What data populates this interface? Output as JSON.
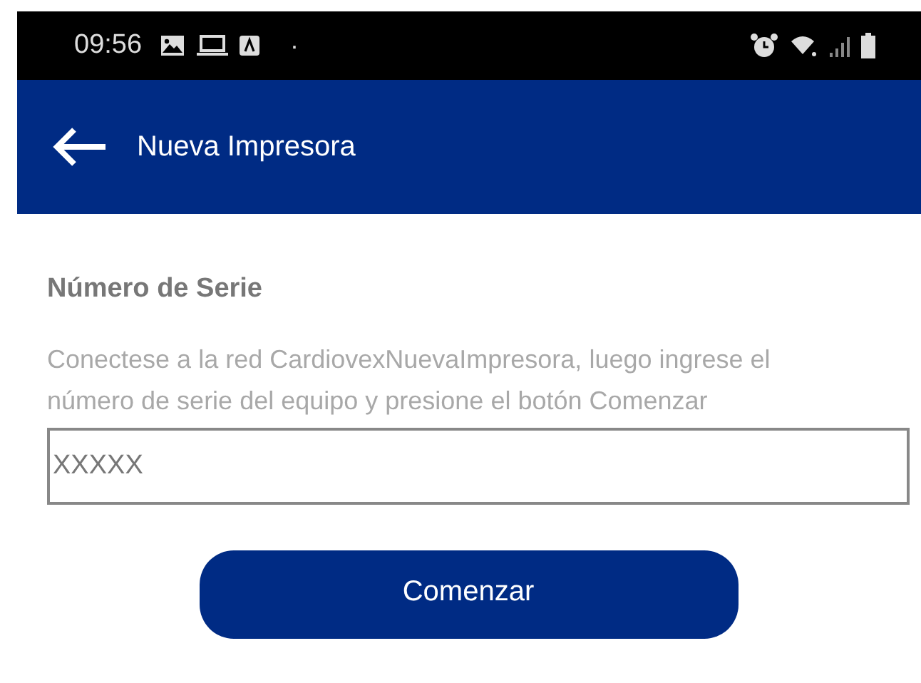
{
  "status_bar": {
    "time": "09:56",
    "dot": "·"
  },
  "app_bar": {
    "title": "Nueva Impresora"
  },
  "section": {
    "heading": "Número de Serie",
    "instructions": "Conectese a la red CardiovexNuevaImpresora, luego ingrese el número de serie del equipo y presione el botón Comenzar"
  },
  "serial_field": {
    "placeholder": "XXXXX"
  },
  "buttons": [
    "Comenzar"
  ]
}
